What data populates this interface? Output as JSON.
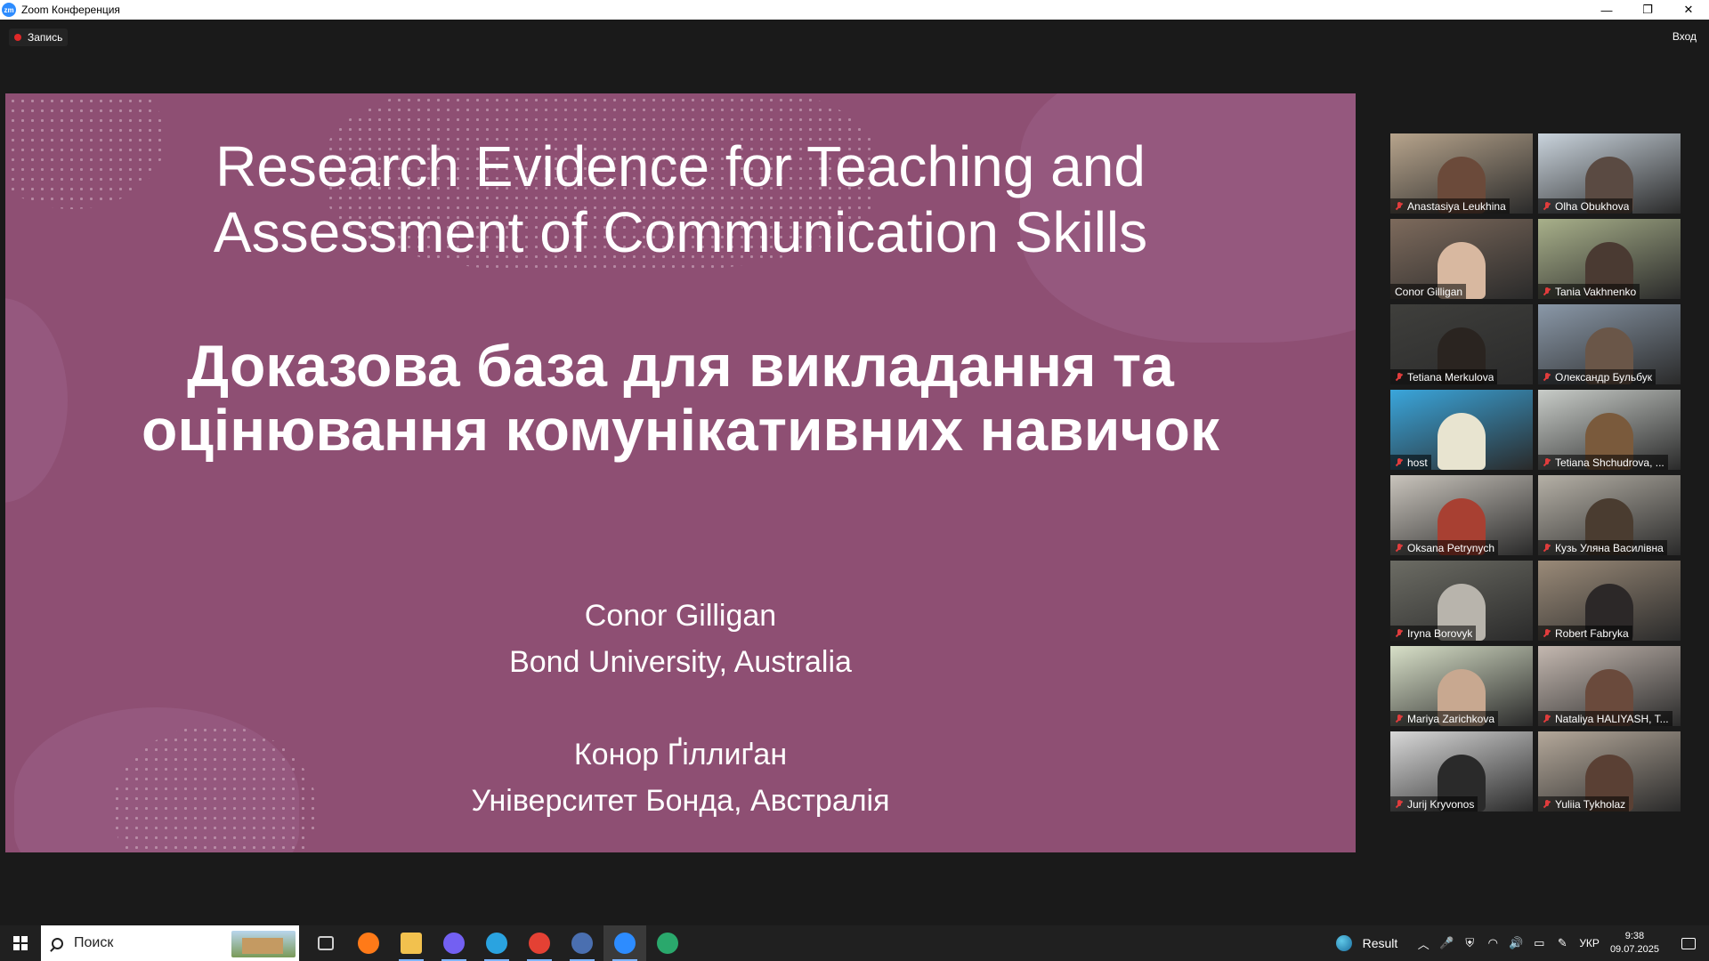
{
  "window": {
    "icon_text": "zm",
    "title": "Zoom Конференция",
    "minimize_glyph": "—",
    "restore_glyph": "❐",
    "close_glyph": "✕"
  },
  "meeting": {
    "recording_label": "Запись",
    "signin_label": "Вход"
  },
  "slide": {
    "title_en_line1": "Research Evidence for Teaching and",
    "title_en_line2": "Assessment of Communication Skills",
    "title_uk_line1": "Доказова база для викладання та",
    "title_uk_line2": "оцінювання комунікативних навичок",
    "author_en": "Conor Gilligan",
    "affiliation_en": "Bond University, Australia",
    "author_uk": "Конор Ґіллиґан",
    "affiliation_uk": "Університет Бонда, Австралія",
    "colors": {
      "background": "#8e4f73",
      "blob": "#9b6186",
      "text": "#ffffff"
    }
  },
  "participants": [
    {
      "name": "Anastasiya Leukhina",
      "muted": true,
      "active": false,
      "bg": "#b7a48c",
      "person": "#6b4a3a"
    },
    {
      "name": "Olha Obukhova",
      "muted": true,
      "active": false,
      "bg": "#c9d3dc",
      "person": "#5a4a42"
    },
    {
      "name": "Conor Gilligan",
      "muted": false,
      "active": true,
      "bg": "#7d6a5c",
      "person": "#d8b8a0"
    },
    {
      "name": "Tania Vakhnenko",
      "muted": true,
      "active": false,
      "bg": "#a8b08a",
      "person": "#4a3a32"
    },
    {
      "name": "Tetiana Merkulova",
      "muted": true,
      "active": false,
      "bg": "#3f3f3c",
      "person": "#2a2420"
    },
    {
      "name": "Олександр Бульбук",
      "muted": true,
      "active": false,
      "bg": "#8a98a8",
      "person": "#6a5648"
    },
    {
      "name": "host",
      "muted": true,
      "active": false,
      "bg": "#3aa6dc",
      "person": "#e8e4d0"
    },
    {
      "name": "Tetiana Shchudrova, ...",
      "muted": true,
      "active": false,
      "bg": "#c8ccc8",
      "person": "#7a5a3c"
    },
    {
      "name": "Oksana Petrynych",
      "muted": true,
      "active": false,
      "bg": "#c9c4bc",
      "person": "#a84032"
    },
    {
      "name": "Кузь Уляна Василівна",
      "muted": true,
      "active": false,
      "bg": "#b5b0a6",
      "person": "#4a3c30"
    },
    {
      "name": "Iryna Borovyk",
      "muted": true,
      "active": false,
      "bg": "#6c6c64",
      "person": "#b8b4ac"
    },
    {
      "name": "Robert Fabryka",
      "muted": true,
      "active": false,
      "bg": "#9a8a78",
      "person": "#2c2828"
    },
    {
      "name": "Mariya Zarichkova",
      "muted": true,
      "active": false,
      "bg": "#d8e0c8",
      "person": "#c8a890"
    },
    {
      "name": "Nataliya HALIYASH, T...",
      "muted": true,
      "active": false,
      "bg": "#c4b8b0",
      "person": "#6a4a3c"
    },
    {
      "name": "Jurij Kryvonos",
      "muted": true,
      "active": false,
      "bg": "#d8d8d8",
      "person": "#2a2a2a"
    },
    {
      "name": "Yuliia Tykholaz",
      "muted": true,
      "active": false,
      "bg": "#b4a89a",
      "person": "#5a4034"
    }
  ],
  "taskbar": {
    "search_placeholder": "Поиск",
    "apps": [
      {
        "icon": "task-view-icon",
        "color": "#cfcfcf",
        "active": false,
        "selected": false
      },
      {
        "icon": "firefox-icon",
        "color": "#ff7a18",
        "active": false,
        "selected": false
      },
      {
        "icon": "file-explorer-icon",
        "color": "#f2c14e",
        "active": true,
        "selected": false
      },
      {
        "icon": "viber-icon",
        "color": "#7360f2",
        "active": true,
        "selected": false
      },
      {
        "icon": "telegram-icon",
        "color": "#2aa3e0",
        "active": true,
        "selected": false
      },
      {
        "icon": "chrome-icon",
        "color": "#e44134",
        "active": true,
        "selected": false
      },
      {
        "icon": "app-icon",
        "color": "#4a6fb0",
        "active": true,
        "selected": false
      },
      {
        "icon": "zoom-icon",
        "color": "#2d8cff",
        "active": true,
        "selected": true
      },
      {
        "icon": "edge-icon",
        "color": "#2aa86c",
        "active": false,
        "selected": false
      }
    ],
    "tray": {
      "result_label": "Result",
      "chevron": "︿",
      "mic": "🎤",
      "shield": "⛨",
      "wifi": "◠",
      "volume": "🔊",
      "battery": "▭",
      "pen": "✎",
      "language": "УКР",
      "time": "9:38",
      "date": "09.07.2025"
    }
  }
}
